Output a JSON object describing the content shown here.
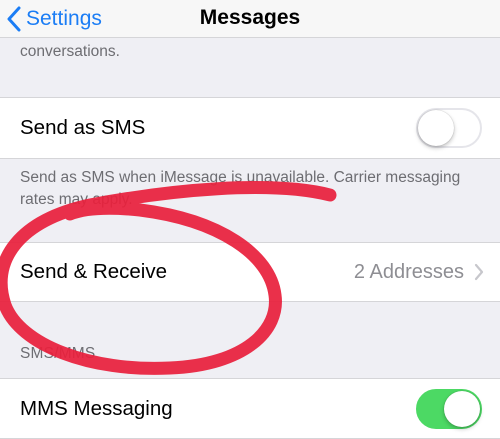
{
  "navbar": {
    "back_label": "Settings",
    "title": "Messages"
  },
  "footnote_top": "conversations.",
  "send_as_sms": {
    "label": "Send as SMS",
    "toggle_on": false,
    "footnote": "Send as SMS when iMessage is unavailable. Carrier messaging rates may apply."
  },
  "send_receive": {
    "label": "Send & Receive",
    "detail": "2 Addresses"
  },
  "sms_mms_section": {
    "header": "SMS/MMS",
    "mms_messaging": {
      "label": "MMS Messaging",
      "toggle_on": true
    }
  },
  "colors": {
    "accent": "#1b7df5",
    "toggle_on": "#4cd964",
    "annotation": "#e8203c",
    "background": "#efeff4"
  },
  "icons": {
    "back": "chevron-left-icon",
    "disclosure": "chevron-right-icon"
  }
}
